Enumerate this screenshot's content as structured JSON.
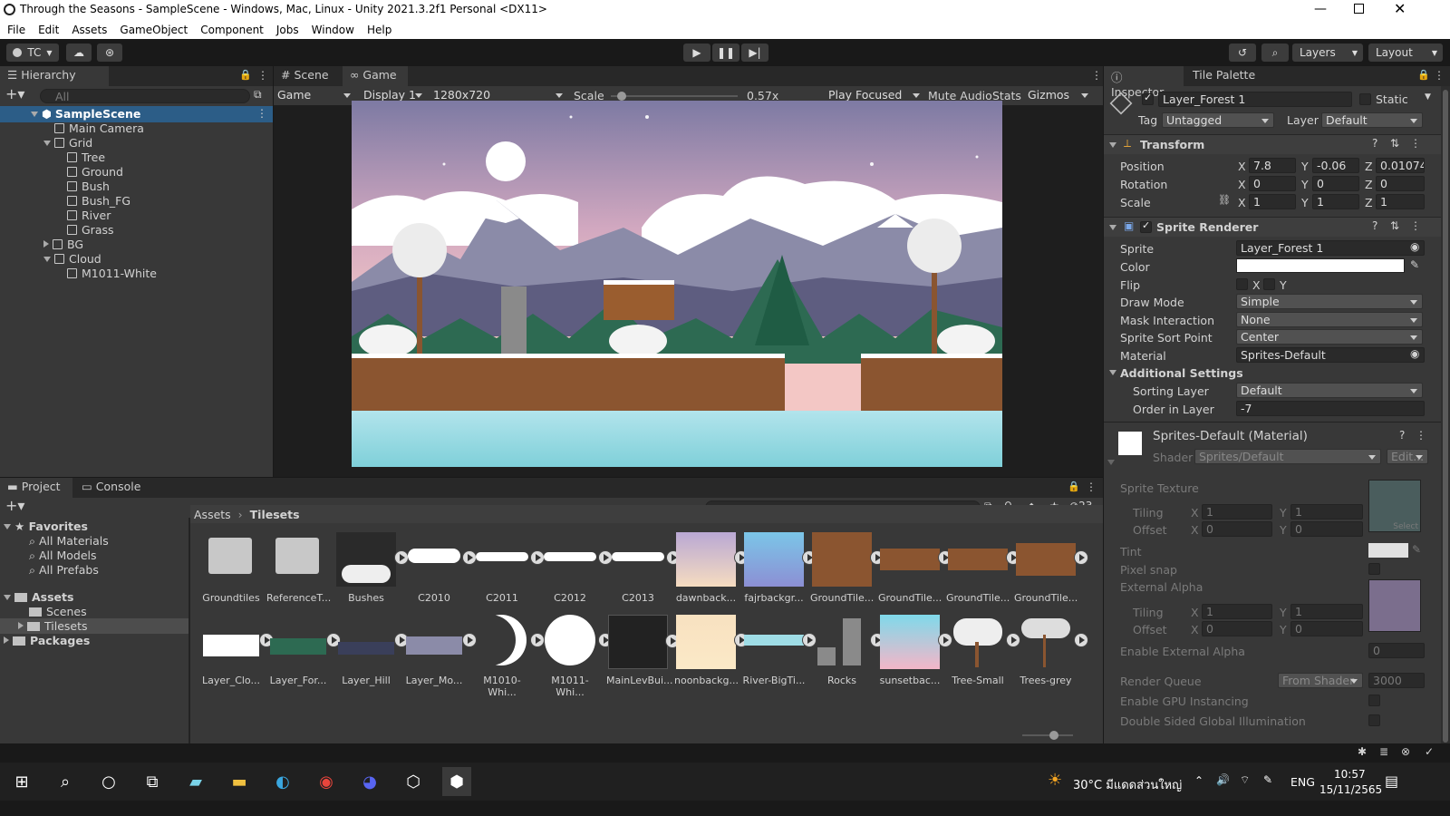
{
  "window": {
    "title": "Through the Seasons - SampleScene - Windows, Mac, Linux - Unity 2021.3.2f1 Personal <DX11>"
  },
  "menu": [
    "File",
    "Edit",
    "Assets",
    "GameObject",
    "Component",
    "Jobs",
    "Window",
    "Help"
  ],
  "toolbar": {
    "account": "TC",
    "layers": "Layers",
    "layout": "Layout"
  },
  "hierarchy": {
    "tab": "Hierarchy",
    "search_placeholder": "All",
    "items": [
      {
        "label": "SampleScene",
        "depth": 0
      },
      {
        "label": "Main Camera",
        "depth": 1
      },
      {
        "label": "Grid",
        "depth": 1
      },
      {
        "label": "Tree",
        "depth": 2
      },
      {
        "label": "Ground",
        "depth": 2
      },
      {
        "label": "Bush",
        "depth": 2
      },
      {
        "label": "Bush_FG",
        "depth": 2
      },
      {
        "label": "River",
        "depth": 2
      },
      {
        "label": "Grass",
        "depth": 2
      },
      {
        "label": "BG",
        "depth": 1
      },
      {
        "label": "Cloud",
        "depth": 1
      },
      {
        "label": "M1011-White",
        "depth": 2
      }
    ]
  },
  "game_view": {
    "tab_scene": "Scene",
    "tab_game": "Game",
    "game_dropdown": "Game",
    "display": "Display 1",
    "resolution": "1280x720",
    "scale_label": "Scale",
    "scale_value": "0.57x",
    "scale_fraction": 0.05,
    "play_focused": "Play Focused",
    "mute_audio": "Mute Audio",
    "stats": "Stats",
    "gizmos": "Gizmos"
  },
  "inspector": {
    "tab": "Inspector",
    "tab2": "Tile Palette",
    "object_name": "Layer_Forest 1",
    "static": "Static",
    "tag_label": "Tag",
    "tag": "Untagged",
    "layer_label": "Layer",
    "layer": "Default",
    "transform": {
      "title": "Transform",
      "position_label": "Position",
      "pos_x": "7.8",
      "pos_y": "-0.06",
      "pos_z": "0.01074",
      "rotation_label": "Rotation",
      "rot_x": "0",
      "rot_y": "0",
      "rot_z": "0",
      "scale_label": "Scale",
      "scale_x": "1",
      "scale_y": "1",
      "scale_z": "1"
    },
    "sprite_renderer": {
      "title": "Sprite Renderer",
      "sprite_label": "Sprite",
      "sprite": "Layer_Forest 1",
      "color_label": "Color",
      "flip_label": "Flip",
      "flip_x": "X",
      "flip_y": "Y",
      "draw_mode_label": "Draw Mode",
      "draw_mode": "Simple",
      "mask_label": "Mask Interaction",
      "mask": "None",
      "sort_point_label": "Sprite Sort Point",
      "sort_point": "Center",
      "material_label": "Material",
      "material": "Sprites-Default",
      "additional": "Additional Settings",
      "sorting_layer_label": "Sorting Layer",
      "sorting_layer": "Default",
      "order_label": "Order in Layer",
      "order": "-7"
    },
    "material": {
      "title": "Sprites-Default (Material)",
      "shader_label": "Shader",
      "shader": "Sprites/Default",
      "edit": "Edit...",
      "sprite_texture": "Sprite Texture",
      "tiling": "Tiling",
      "offset": "Offset",
      "tiling_x": "1",
      "tiling_y": "1",
      "offset_x": "0",
      "offset_y": "0",
      "select": "Select",
      "tint": "Tint",
      "pixel_snap": "Pixel snap",
      "external_alpha": "External Alpha",
      "tiling2_x": "1",
      "tiling2_y": "1",
      "offset2_x": "0",
      "offset2_y": "0",
      "enable_external_alpha": "Enable External Alpha",
      "enable_external_alpha_value": "0",
      "render_queue": "Render Queue",
      "render_queue_mode": "From Shader",
      "render_queue_value": "3000",
      "gpu_instancing": "Enable GPU Instancing",
      "double_sided": "Double Sided Global Illumination"
    }
  },
  "project": {
    "tab": "Project",
    "tab2": "Console",
    "count": "23",
    "favorites": "Favorites",
    "fav_items": [
      "All Materials",
      "All Models",
      "All Prefabs"
    ],
    "assets": "Assets",
    "asset_folders": [
      "Scenes",
      "Tilesets"
    ],
    "packages": "Packages",
    "breadcrumb_root": "Assets",
    "breadcrumb_current": "Tilesets",
    "row1": [
      "Groundtiles",
      "ReferenceT...",
      "Bushes",
      "C2010",
      "C2011",
      "C2012",
      "C2013",
      "dawnback...",
      "fajrbackgr...",
      "GroundTile...",
      "GroundTile...",
      "GroundTile...",
      "GroundTile..."
    ],
    "row2": [
      "Layer_Clo...",
      "Layer_For...",
      "Layer_Hill",
      "Layer_Mo...",
      "M1010-Whi...",
      "M1011-Whi...",
      "MainLevBui...",
      "noonbackg...",
      "River-BigTi...",
      "Rocks",
      "sunsetbac...",
      "Tree-Small",
      "Trees-grey"
    ]
  },
  "taskbar": {
    "weather": "30°C  มีแดดส่วนใหญ่",
    "lang": "ENG",
    "time": "10:57",
    "date": "15/11/2565"
  }
}
